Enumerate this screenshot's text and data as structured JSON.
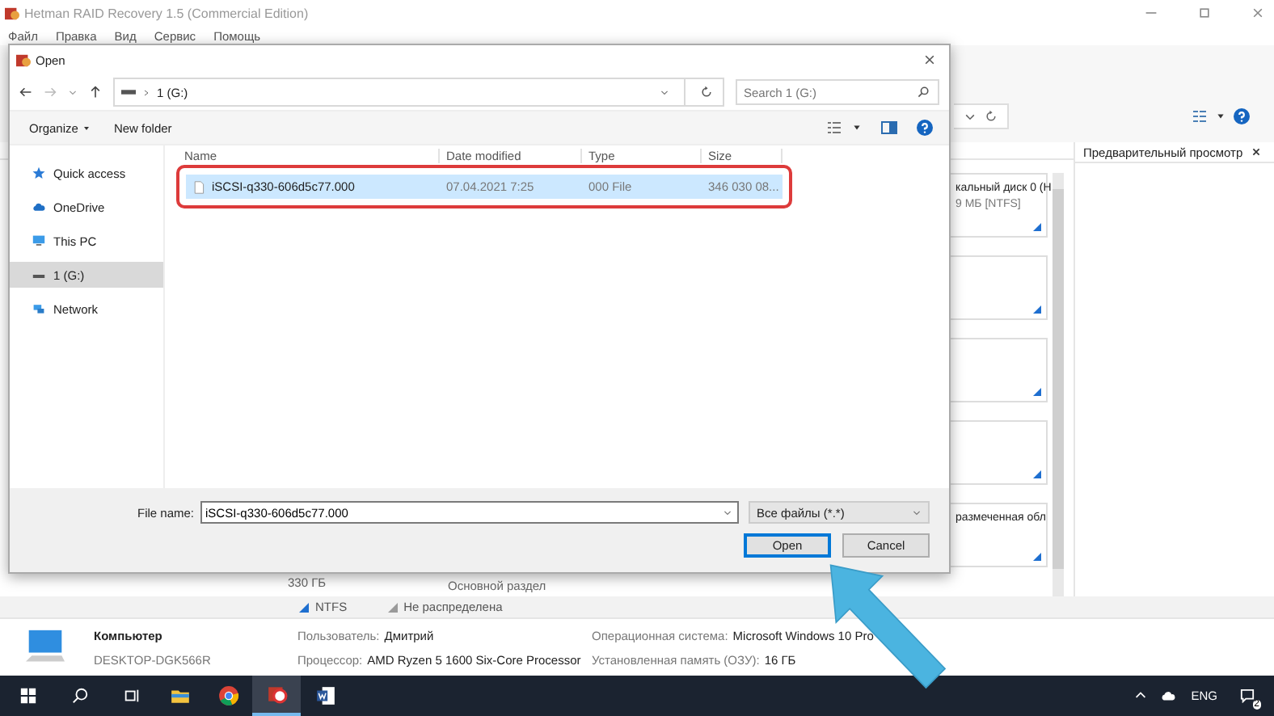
{
  "app": {
    "title": "Hetman RAID Recovery 1.5 (Commercial Edition)",
    "menu": [
      "Файл",
      "Правка",
      "Вид",
      "Сервис",
      "Помощь"
    ],
    "preview_title": "Предварительный просмотр",
    "partitions": [
      {
        "kind": "labeled",
        "title": "кальный диск 0 (H",
        "subtitle": "9 МБ [NTFS]"
      },
      {
        "kind": "blank"
      },
      {
        "kind": "blank"
      },
      {
        "kind": "blank"
      },
      {
        "kind": "labeled",
        "title": "размеченная обл"
      }
    ],
    "disk_texts": [
      "330 ГБ",
      "Основной раздел"
    ],
    "legend": [
      {
        "label": "NTFS",
        "color": "#1e6fd0"
      },
      {
        "label": "Не распределена",
        "color": "#9a9a9a"
      }
    ],
    "info": {
      "name": "Компьютер",
      "host": "DESKTOP-DGK566R",
      "fields": [
        {
          "label": "Пользователь:",
          "value": "Дмитрий"
        },
        {
          "label": "Операционная система:",
          "value": "Microsoft Windows 10 Pro"
        },
        {
          "label": "Процессор:",
          "value": "AMD Ryzen 5 1600 Six-Core Processor"
        },
        {
          "label": "Установленная память (ОЗУ):",
          "value": "16 ГБ"
        }
      ]
    }
  },
  "dialog": {
    "title": "Open",
    "path": "1 (G:)",
    "search_placeholder": "Search 1 (G:)",
    "organize": "Organize",
    "new_folder": "New folder",
    "nav": [
      {
        "label": "Quick access",
        "kind": "star",
        "selected": false
      },
      {
        "label": "OneDrive",
        "kind": "cloud",
        "selected": false
      },
      {
        "label": "This PC",
        "kind": "pc",
        "selected": false
      },
      {
        "label": "1 (G:)",
        "kind": "drive",
        "selected": true
      },
      {
        "label": "Network",
        "kind": "network",
        "selected": false
      }
    ],
    "columns": [
      "Name",
      "Date modified",
      "Type",
      "Size"
    ],
    "rows": [
      {
        "name": "iSCSI-q330-606d5c77.000",
        "date": "07.04.2021 7:25",
        "type": "000 File",
        "size": "346 030 08...",
        "selected": true
      }
    ],
    "file_name_label": "File name:",
    "file_name": "iSCSI-q330-606d5c77.000",
    "filter": "Все файлы (*.*)",
    "buttons": [
      {
        "label": "Open",
        "default": true
      },
      {
        "label": "Cancel",
        "default": false
      }
    ]
  },
  "taskbar": {
    "apps": [
      {
        "kind": "explorer",
        "active": false
      },
      {
        "kind": "chrome",
        "active": false
      },
      {
        "kind": "raid",
        "active": true
      },
      {
        "kind": "word",
        "active": false
      }
    ],
    "language": "ENG",
    "notifications": "2"
  }
}
